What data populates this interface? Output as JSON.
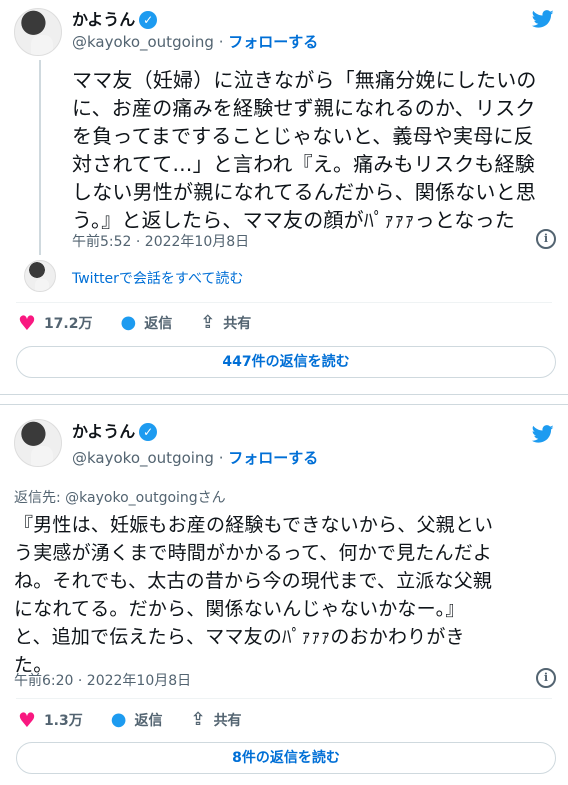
{
  "colors": {
    "accent": "#1d9bf0",
    "link": "#006fd6",
    "like": "#f91880",
    "muted": "#536471",
    "border": "#cfd9de"
  },
  "tweets": [
    {
      "author": {
        "name": "かようん",
        "handle": "@kayoko_outgoing",
        "separator": " · ",
        "follow_label": "フォローする",
        "verified_icon": "verified-badge-icon"
      },
      "text": "ママ友（妊婦）に泣きながら「無痛分娩にしたいの\nに、お産の痛みを経験せず親になれるのか、リスク\nを負ってまですることじゃないと、義母や実母に反\n対されてて…」と言われ『え。痛みもリスクも経験\nしない男性が親になれてるんだから、関係ないと思\nう。』と返したら、ママ友の顔がﾊﾟｧｧｧっとなった",
      "timestamp": "午前5:52 · 2022年10月8日",
      "conversation_link": "Twitterで会話をすべて読む",
      "likes": "17.2万",
      "reply_label": "返信",
      "share_label": "共有",
      "read_replies": "447件の返信を読む"
    },
    {
      "author": {
        "name": "かようん",
        "handle": "@kayoko_outgoing",
        "separator": " · ",
        "follow_label": "フォローする",
        "verified_icon": "verified-badge-icon"
      },
      "reply_to_prefix": "返信先: ",
      "reply_to_handle": "@kayoko_outgoingさん",
      "text": "『男性は、妊娠もお産の経験もできないから、父親とい\nう実感が湧くまで時間がかかるって、何かで見たんだよ\nね。それでも、太古の昔から今の現代まで、立派な父親\nになれてる。だから、関係ないんじゃないかなー。』\nと、追加で伝えたら、ママ友のﾊﾟｧｧｧのおかわりがき\nた。",
      "timestamp": "午前6:20 · 2022年10月8日",
      "likes": "1.3万",
      "reply_label": "返信",
      "share_label": "共有",
      "read_replies": "8件の返信を読む"
    }
  ]
}
